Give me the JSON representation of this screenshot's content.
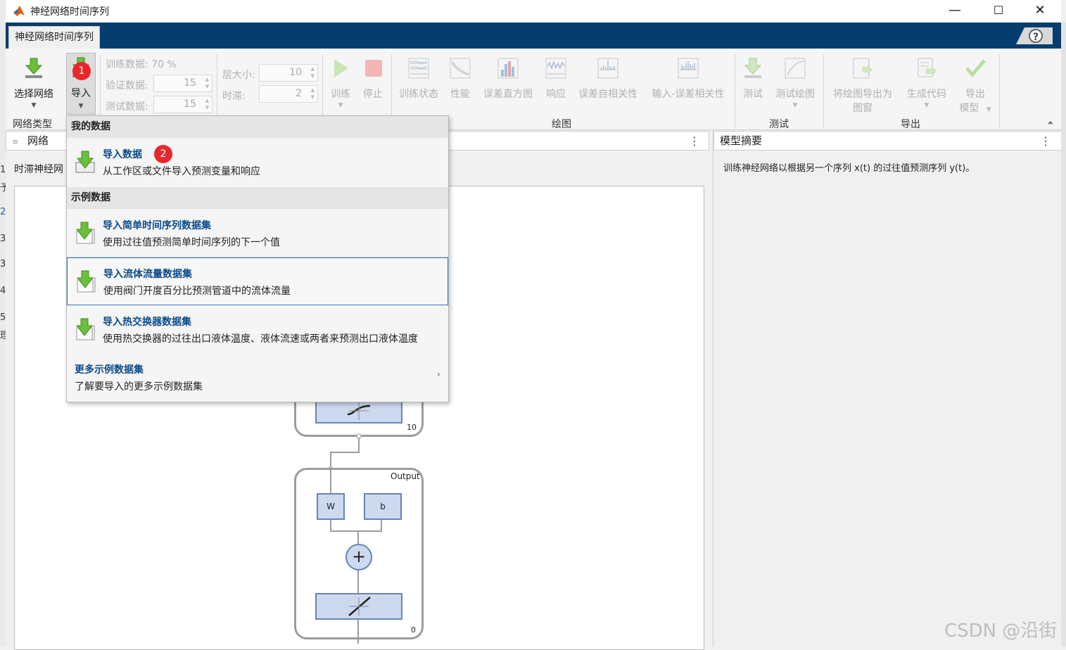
{
  "window": {
    "title": "神经网络时间序列",
    "minimize": "—",
    "maximize": "☐",
    "close": "✕"
  },
  "tab": {
    "label": "神经网络时间序列"
  },
  "help": {
    "label": "?"
  },
  "toolstrip": {
    "select_network": "选择网络",
    "import": "导入",
    "group_network_type": "网络类型",
    "train_data_label": "训练数据: 70 %",
    "val_data_label": "验证数据:",
    "val_data_value": "15",
    "test_data_label": "测试数据:",
    "test_data_value": "15",
    "layer_size_label": "层大小:",
    "layer_size_value": "10",
    "delay_label": "时滞:",
    "delay_value": "2",
    "train": "训练",
    "stop": "停止",
    "train_state": "训练状态",
    "performance": "性能",
    "error_histogram": "误差直方图",
    "response": "响应",
    "error_autocorr": "误差自相关性",
    "input_error_corr": "输入-误差相关性",
    "group_plot": "绘图",
    "test": "测试",
    "test_plot": "测试绘图",
    "group_test": "测试",
    "export_figure_1": "将绘图导出为",
    "export_figure_2": "图窗",
    "generate_code": "生成代码",
    "export_model_1": "导出",
    "export_model_2": "模型",
    "group_export": "导出"
  },
  "badges": {
    "one": "1",
    "two": "2"
  },
  "left_panel": {
    "tab": "网络",
    "subtitle": "时滞神经网"
  },
  "right_panel": {
    "title": "模型摘要",
    "summary": "训练神经网络以根据另一个序列 x(t) 的过往值预测序列 y(t)。"
  },
  "dropdown": {
    "my_data_header": "我的数据",
    "import_data_title": "导入数据",
    "import_data_desc": "从工作区或文件导入预测变量和响应",
    "example_header": "示例数据",
    "items": [
      {
        "title": "导入简单时间序列数据集",
        "desc": "使用过往值预测简单时间序列的下一个值"
      },
      {
        "title": "导入流体流量数据集",
        "desc": "使用阀门开度百分比预测管道中的流体流量"
      },
      {
        "title": "导入热交换器数据集",
        "desc": "使用热交换器的过往出口液体温度、液体流速或两者来预测出口液体温度"
      }
    ],
    "more_title": "更多示例数据集",
    "more_desc": "了解要导入的更多示例数据集",
    "more_arrow": "›"
  },
  "diagram": {
    "hidden_size": "10",
    "output_label": "Output",
    "w_label": "W",
    "b_label": "b",
    "plus": "+",
    "output_size": "0"
  },
  "watermark": "CSDN @沿街",
  "edge_fragments": [
    "1",
    "予",
    "2",
    "3",
    "3",
    "4",
    "5",
    "理"
  ],
  "colors": {
    "ribbon_blue": "#053d6e",
    "badge_red": "#e6282d",
    "link_blue": "#0b4a8a",
    "weight_fill": "#cdd9ef"
  }
}
